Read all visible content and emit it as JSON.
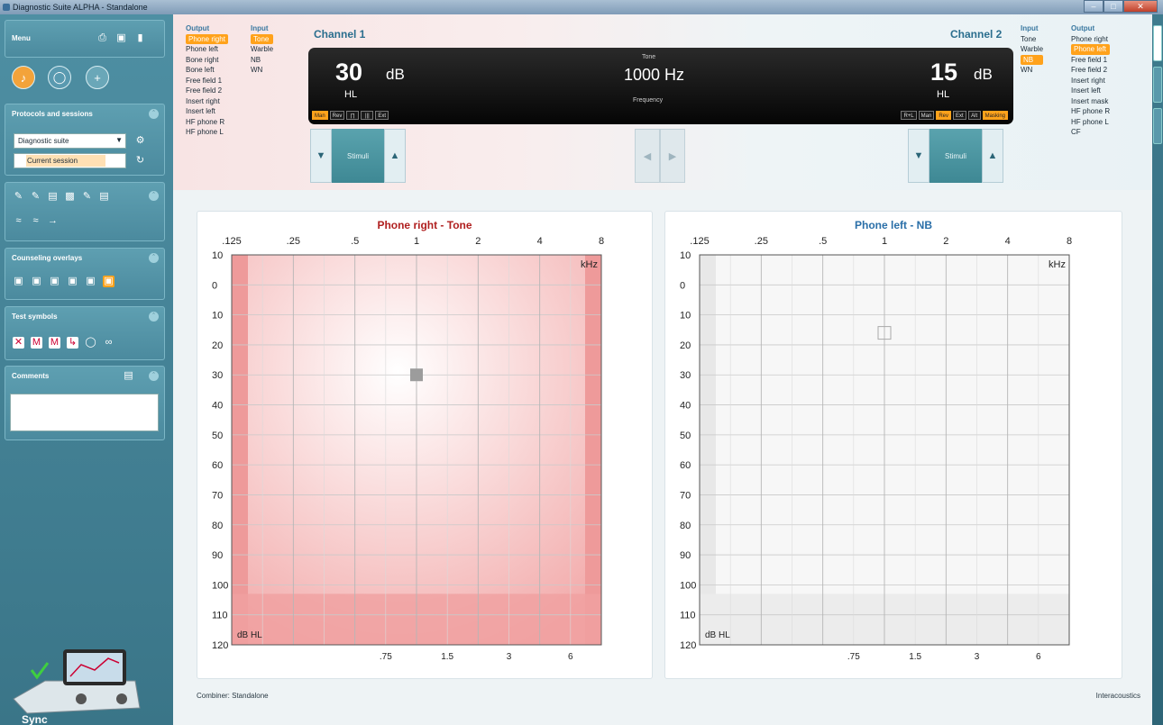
{
  "titlebar": {
    "title": "Diagnostic Suite ALPHA - Standalone"
  },
  "sidebar": {
    "menu_label": "Menu",
    "protocols_title": "Protocols and sessions",
    "protocol_value": "Diagnostic suite",
    "session_value": "Current session",
    "counseling_title": "Counseling overlays",
    "test_symbols_title": "Test symbols",
    "comments_title": "Comments",
    "sync_label": "Sync"
  },
  "channel1": {
    "label": "Channel 1",
    "output_head": "Output",
    "input_head": "Input",
    "outputs": [
      "Phone right",
      "Phone left",
      "Bone right",
      "Bone left",
      "Free field 1",
      "Free field 2",
      "Insert right",
      "Insert left",
      "HF phone R",
      "HF phone L"
    ],
    "inputs": [
      "Tone",
      "Warble",
      "NB",
      "WN"
    ],
    "value": "30",
    "unit": "dB",
    "hl": "HL",
    "indicators": [
      "Man",
      "Rev",
      "∏",
      "|||",
      "Ext"
    ],
    "stim_label": "Stimuli"
  },
  "channel2": {
    "label": "Channel 2",
    "output_head": "Output",
    "input_head": "Input",
    "outputs": [
      "Phone right",
      "Phone left",
      "Free field 1",
      "Free field 2",
      "Insert right",
      "Insert left",
      "Insert mask",
      "HF phone R",
      "HF phone L",
      "CF"
    ],
    "inputs": [
      "Tone",
      "Warble",
      "NB",
      "WN"
    ],
    "value": "15",
    "unit": "dB",
    "hl": "HL",
    "indicators": [
      "R+L",
      "Man",
      "Rev",
      "Ext",
      "Alt",
      "Masking"
    ],
    "stim_label": "Stimuli"
  },
  "center": {
    "type_label": "Tone",
    "freq": "1000 Hz",
    "freq_label": "Frequency"
  },
  "graph_left": {
    "title": "Phone right - Tone",
    "color": "#b02020",
    "x_top": [
      ".125",
      ".25",
      ".5",
      "1",
      "2",
      "4",
      "8"
    ],
    "unit": "kHz",
    "y": [
      "10",
      "0",
      "10",
      "20",
      "30",
      "40",
      "50",
      "60",
      "70",
      "80",
      "90",
      "100",
      "110",
      "120"
    ],
    "y_unit": "dB HL",
    "x_bottom": [
      ".75",
      "1.5",
      "3",
      "6"
    ]
  },
  "graph_right": {
    "title": "Phone left - NB",
    "color": "#2a6fa8",
    "x_top": [
      ".125",
      ".25",
      ".5",
      "1",
      "2",
      "4",
      "8"
    ],
    "unit": "kHz",
    "y": [
      "10",
      "0",
      "10",
      "20",
      "30",
      "40",
      "50",
      "60",
      "70",
      "80",
      "90",
      "100",
      "110",
      "120"
    ],
    "y_unit": "dB HL",
    "x_bottom": [
      ".75",
      "1.5",
      "3",
      "6"
    ]
  },
  "footer": {
    "left": "Combiner: Standalone",
    "right": "Interacoustics"
  }
}
